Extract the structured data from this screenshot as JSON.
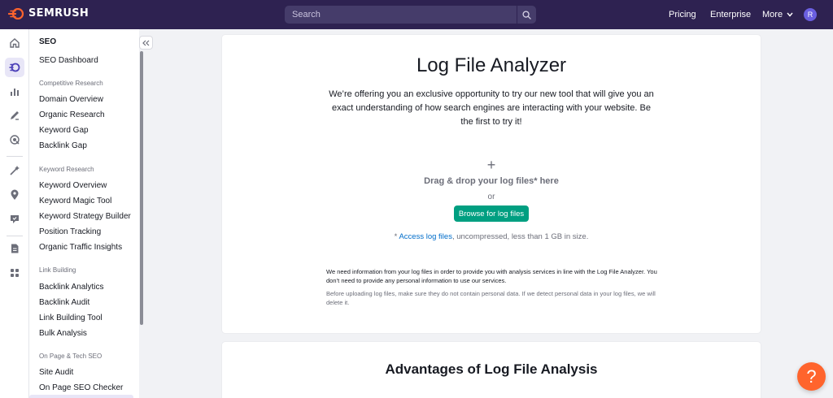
{
  "brand": {
    "name": "SEMRUSH",
    "accent": "#ff642d",
    "topbar_bg": "#2e2251"
  },
  "search": {
    "placeholder": "Search"
  },
  "topnav": {
    "pricing": "Pricing",
    "enterprise": "Enterprise",
    "more": "More",
    "avatar_initial": "R"
  },
  "rail": {
    "icons": [
      "home-icon",
      "seo-icon",
      "analytics-icon",
      "content-icon",
      "local-icon",
      "ai-icon",
      "location-icon",
      "reviews-icon",
      "reports-icon",
      "apps-icon"
    ]
  },
  "sidebar": {
    "title": "SEO",
    "dashboard": "SEO Dashboard",
    "sections": [
      {
        "label": "Competitive Research",
        "items": [
          "Domain Overview",
          "Organic Research",
          "Keyword Gap",
          "Backlink Gap"
        ]
      },
      {
        "label": "Keyword Research",
        "items": [
          "Keyword Overview",
          "Keyword Magic Tool",
          "Keyword Strategy Builder",
          "Position Tracking",
          "Organic Traffic Insights"
        ]
      },
      {
        "label": "Link Building",
        "items": [
          "Backlink Analytics",
          "Backlink Audit",
          "Link Building Tool",
          "Bulk Analysis"
        ]
      },
      {
        "label": "On Page & Tech SEO",
        "items": [
          "Site Audit",
          "On Page SEO Checker"
        ]
      }
    ]
  },
  "main": {
    "title": "Log File Analyzer",
    "intro": "We’re offering you an exclusive opportunity to try our new tool that will give you an exact understanding of how search engines are interacting with your website. Be the first to try it!",
    "plus": "+",
    "drag_text": "Drag & drop your log files* here",
    "or_text": "or",
    "browse_button": "Browse for log files",
    "access_star": "* ",
    "access_link": "Access log files",
    "access_rest": ", uncompressed, less than 1 GB in size.",
    "notice_primary": "We need information from your log files in order to provide you with analysis services in line with the Log File Analyzer. You don’t need to provide any personal information to use our services.",
    "notice_secondary": "Before uploading log files, make sure they do not contain personal data. If we detect personal data in your log files, we will delete it.",
    "advantages_title": "Advantages of Log File Analysis"
  },
  "help": {
    "label": "?"
  }
}
